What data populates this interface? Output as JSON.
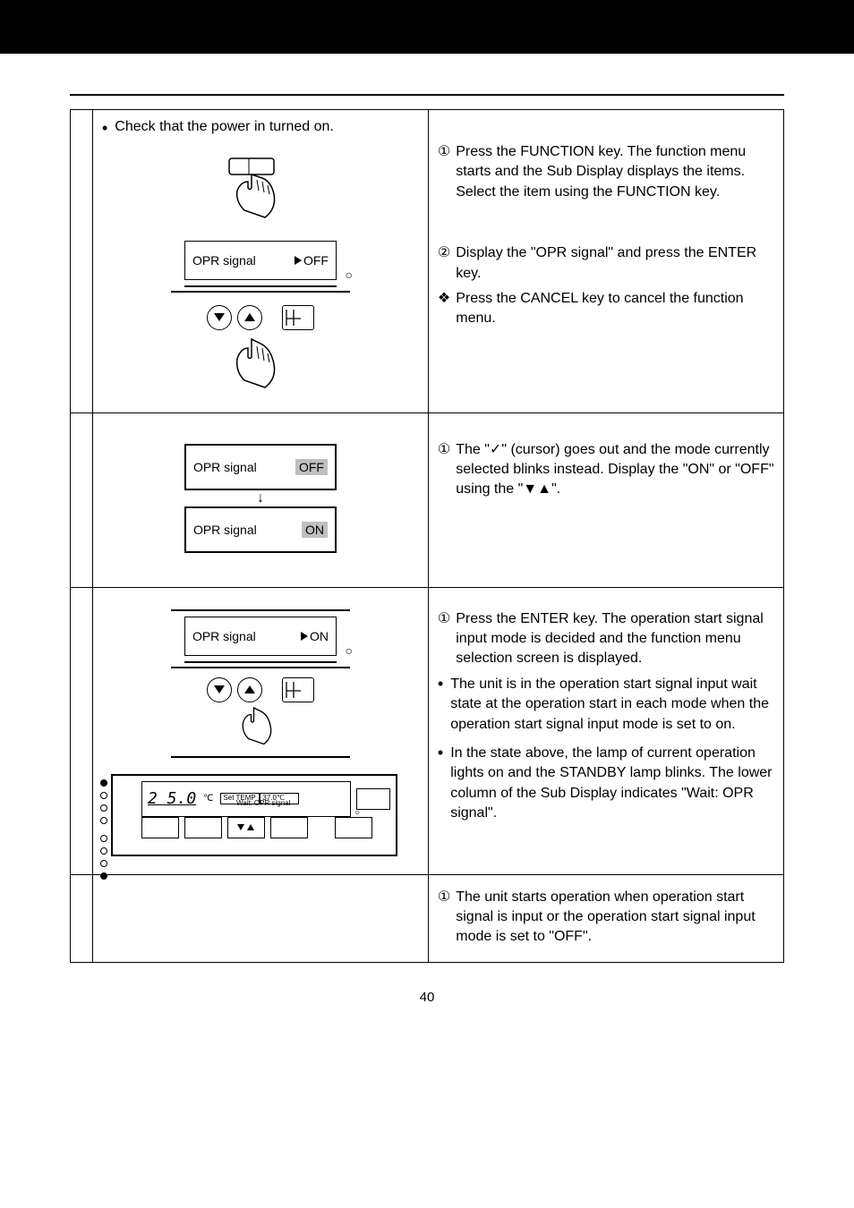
{
  "topbar": "",
  "row1": {
    "left_bullet": "Check that the power in turned on.",
    "disp_label": "OPR signal",
    "disp_value": "OFF",
    "r_item1_num": "①",
    "r_item1": "Press the FUNCTION key.  The function menu starts and the Sub Display displays the items.  Select the item using the FUNCTION key.",
    "r_item2_num": "②",
    "r_item2": "Display the \"OPR signal\" and press the ENTER key.",
    "r_item3_sym": "❖",
    "r_item3": "Press the CANCEL key to cancel the function menu."
  },
  "row2": {
    "disp1_label": "OPR signal",
    "disp1_value": "OFF",
    "disp2_label": "OPR signal",
    "disp2_value": "ON",
    "r_item1_num": "①",
    "r_item1": "The \"✓\" (cursor) goes out and the mode currently selected blinks instead.  Display the \"ON\" or \"OFF\" using the \"▼▲\"."
  },
  "row3": {
    "disp_label": "OPR signal",
    "disp_value": "ON",
    "seg": "2 5.0",
    "seg_unit": "℃",
    "settemp_label": "Set TEMP",
    "settemp_val": "37.0℃",
    "wait_label": "Wait:",
    "wait_val": "OPR signal",
    "r_item1_num": "①",
    "r_item1": "Press the ENTER key.  The operation start signal input mode is decided and the function menu selection screen is displayed.",
    "r_bullet1": "The unit is in the operation start signal input wait state at the operation start in each mode when the operation start signal input mode is set to on.",
    "r_bullet2": "In the state above, the lamp of current operation lights on and the STANDBY lamp blinks.  The lower column of the Sub Display indicates \"Wait: OPR signal\"."
  },
  "row4": {
    "r_item1_num": "①",
    "r_item1": "The unit starts operation when operation start signal is input or the operation  start signal input mode is set to \"OFF\"."
  },
  "page_number": "40"
}
